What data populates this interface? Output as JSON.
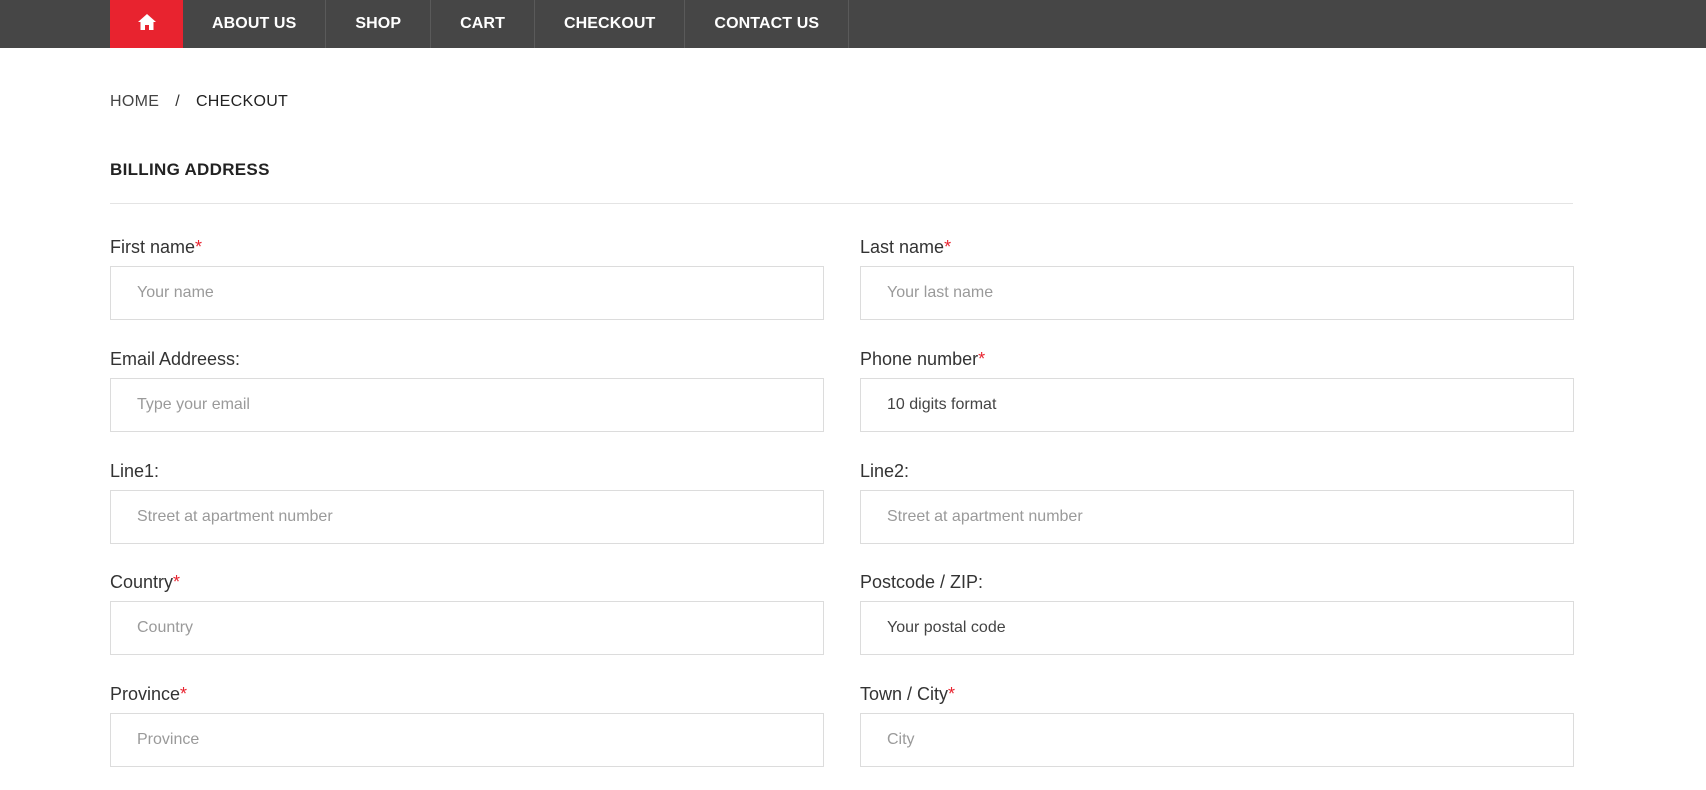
{
  "nav": {
    "home_icon": "home-icon",
    "items": [
      "ABOUT US",
      "SHOP",
      "CART",
      "CHECKOUT",
      "CONTACT US"
    ]
  },
  "breadcrumb": {
    "home": "HOME",
    "separator": "/",
    "current": "CHECKOUT"
  },
  "billing": {
    "title": "BILLING ADDRESS",
    "fields": {
      "first_name": {
        "label": "First name",
        "required": "*",
        "placeholder": "Your name"
      },
      "last_name": {
        "label": "Last name",
        "required": "*",
        "placeholder": "Your last name"
      },
      "email": {
        "label": "Email Addreess:",
        "placeholder": "Type your email"
      },
      "phone": {
        "label": "Phone number",
        "required": "*",
        "placeholder": "10 digits format"
      },
      "line1": {
        "label": "Line1:",
        "placeholder": "Street at apartment number"
      },
      "line2": {
        "label": "Line2:",
        "placeholder": "Street at apartment number"
      },
      "country": {
        "label": "Country",
        "required": "*",
        "placeholder": "Country"
      },
      "postcode": {
        "label": "Postcode / ZIP:",
        "placeholder": "Your postal code"
      },
      "province": {
        "label": "Province",
        "required": "*",
        "placeholder": "Province"
      },
      "city": {
        "label": "Town / City",
        "required": "*",
        "placeholder": "City"
      }
    }
  },
  "colors": {
    "nav_bg": "#464646",
    "accent": "#e8232f"
  }
}
